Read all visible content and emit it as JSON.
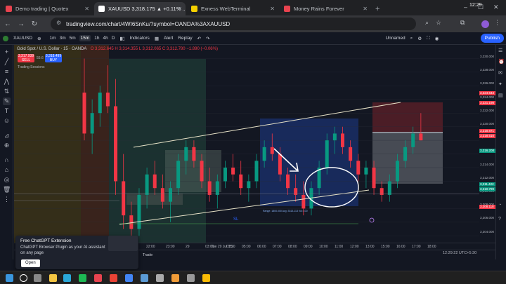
{
  "browser": {
    "tabs": [
      {
        "title": "Demo trading | Quotex",
        "color": "#e8434f",
        "active": false
      },
      {
        "title": "XAUUSD 3,318.175 ▲ +0.11% ...",
        "color": "#ffffff",
        "active": true
      },
      {
        "title": "Exness WebTerminal",
        "color": "#f5d000",
        "active": false
      },
      {
        "title": "Money Rains Forever",
        "color": "#e8434f",
        "active": false
      }
    ],
    "url": "tradingview.com/chart/4WI6SnKu/?symbol=OANDA%3AXAUUSD"
  },
  "tv_header": {
    "symbol": "XAUUSD",
    "timeframes": [
      "1m",
      "3m",
      "5m",
      "15m",
      "1h",
      "4h",
      "D"
    ],
    "active_timeframe": "15m",
    "indicators_label": "Indicators",
    "alert_label": "Alert",
    "replay_label": "Replay",
    "layout_label": "Unnamed",
    "publish_label": "Publish"
  },
  "legend": {
    "title": "Gold Spot / U.S. Dollar · 15 · OANDA",
    "ohlc": "O 3,312.645 H 3,314.355 L 3,312.065 C 3,312.780 −1.890 (−0.06%)",
    "sell_price": "3,317.939",
    "sell_label": "SELL",
    "spread": "55.6",
    "buy_price": "3,318.499",
    "buy_label": "BUY",
    "sessions_label": "Trading Sessions"
  },
  "price_axis": {
    "ticks": [
      "3,330.000",
      "3,328.000",
      "3,326.000",
      "3,324.000",
      "3,322.000",
      "3,320.000",
      "3,318.000",
      "3,316.000",
      "3,314.000",
      "3,312.000",
      "3,310.000",
      "3,308.000",
      "3,306.000",
      "3,304.000"
    ],
    "labels": [
      {
        "text": "3,324.643",
        "color": "#f23645"
      },
      {
        "text": "3,321.198",
        "color": "#f23645"
      },
      {
        "text": "3,318.871",
        "color": "#f23645"
      },
      {
        "text": "3,318.510",
        "color": "#f23645"
      },
      {
        "text": "3,316.208",
        "color": "#089981"
      },
      {
        "text": "3,311.422",
        "color": "#089981"
      },
      {
        "text": "3,310.799",
        "color": "#089981"
      },
      {
        "text": "3,308.118",
        "color": "#f23645"
      }
    ]
  },
  "time_axis": {
    "ticks": [
      "20:00",
      "22:00",
      "23:00",
      "29",
      "03:00",
      "Tue 29 Jul '25",
      "03:30",
      "05:00",
      "06:00",
      "07:00",
      "08:00",
      "09:00",
      "10:00",
      "11:00",
      "12:00",
      "13:00",
      "15:00",
      "16:00",
      "17:00",
      "18:00"
    ],
    "clock": "12:29:22 UTC+5:30"
  },
  "drawing": {
    "sl_label": "SL",
    "range_info": "Range: 1800.000  Avg: 3313.113  Vol: 100"
  },
  "popup": {
    "title": "Free ChatGPT Extension",
    "body": "ChatGPT Browser Plugin as your AI assistant on any page",
    "button": "Open"
  },
  "bottom": {
    "trade_label": "Trade"
  },
  "taskbar": {
    "time": "12:29"
  },
  "chart_data": {
    "type": "candlestick",
    "symbol": "XAUUSD",
    "timeframe": "15",
    "ylim": [
      3303,
      3332
    ],
    "candles": [
      [
        3325,
        3330,
        3318,
        3319
      ],
      [
        3319,
        3324,
        3316,
        3322
      ],
      [
        3322,
        3326,
        3320,
        3325
      ],
      [
        3325,
        3329,
        3322,
        3323
      ],
      [
        3323,
        3327,
        3310,
        3312
      ],
      [
        3312,
        3316,
        3305,
        3307
      ],
      [
        3307,
        3309,
        3303,
        3305
      ],
      [
        3305,
        3311,
        3304,
        3310
      ],
      [
        3310,
        3314,
        3308,
        3313
      ],
      [
        3313,
        3315,
        3310,
        3311
      ],
      [
        3311,
        3313,
        3308,
        3309
      ],
      [
        3309,
        3312,
        3306,
        3311
      ],
      [
        3311,
        3316,
        3310,
        3315
      ],
      [
        3315,
        3318,
        3313,
        3317
      ],
      [
        3317,
        3318,
        3314,
        3315
      ],
      [
        3315,
        3316,
        3311,
        3312
      ],
      [
        3312,
        3314,
        3309,
        3310
      ],
      [
        3310,
        3313,
        3308,
        3312
      ],
      [
        3312,
        3315,
        3311,
        3314
      ],
      [
        3314,
        3316,
        3312,
        3313
      ],
      [
        3313,
        3315,
        3310,
        3311
      ],
      [
        3311,
        3313,
        3309,
        3312
      ],
      [
        3312,
        3316,
        3311,
        3315
      ],
      [
        3315,
        3318,
        3314,
        3317
      ],
      [
        3317,
        3319,
        3315,
        3316
      ],
      [
        3316,
        3317,
        3312,
        3313
      ],
      [
        3313,
        3314,
        3310,
        3311
      ],
      [
        3311,
        3313,
        3309,
        3310
      ],
      [
        3310,
        3312,
        3307,
        3308
      ],
      [
        3308,
        3312,
        3307,
        3311
      ],
      [
        3311,
        3315,
        3310,
        3314
      ],
      [
        3314,
        3319,
        3313,
        3318
      ],
      [
        3318,
        3320,
        3316,
        3319
      ],
      [
        3319,
        3320,
        3316,
        3317
      ],
      [
        3317,
        3318,
        3314,
        3315
      ],
      [
        3315,
        3316,
        3312,
        3313
      ],
      [
        3313,
        3315,
        3311,
        3314
      ],
      [
        3314,
        3315,
        3310,
        3311
      ],
      [
        3311,
        3312,
        3309,
        3310
      ],
      [
        3310,
        3313,
        3309,
        3312
      ],
      [
        3312,
        3316,
        3311,
        3315
      ],
      [
        3315,
        3318,
        3314,
        3317
      ],
      [
        3317,
        3320,
        3316,
        3319
      ],
      [
        3319,
        3322,
        3318,
        3318
      ]
    ]
  },
  "colors": {
    "bull": "#089981",
    "bear": "#f23645",
    "bg": "#131722",
    "accent": "#2962ff"
  }
}
